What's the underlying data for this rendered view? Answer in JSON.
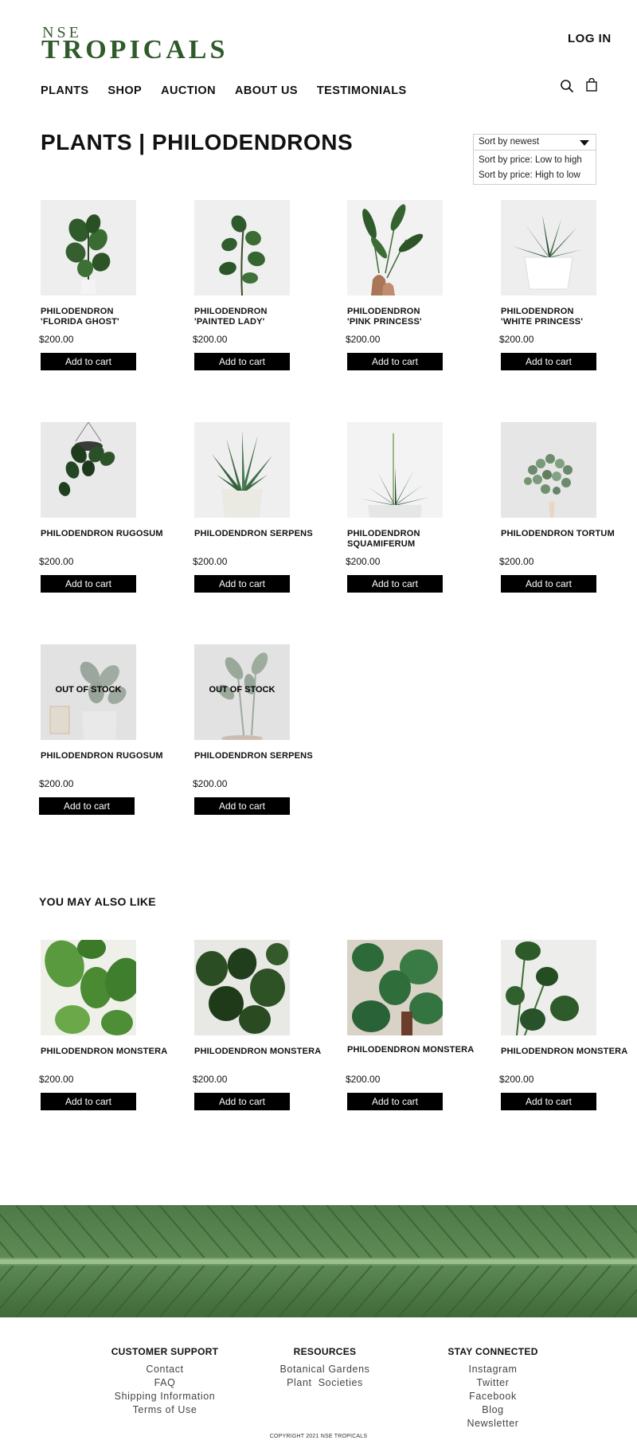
{
  "brand": {
    "line1": "NSE",
    "line2": "TROPICALS"
  },
  "header": {
    "login_label": "LOG IN",
    "nav": [
      {
        "label": "PLANTS"
      },
      {
        "label": "SHOP"
      },
      {
        "label": "AUCTION"
      },
      {
        "label": "ABOUT US"
      },
      {
        "label": "TESTIMONIALS"
      }
    ],
    "icons": {
      "search": "search-icon",
      "cart": "shopping-bag-icon"
    }
  },
  "page": {
    "title": "PLANTS |  PHILODENDRONS"
  },
  "sort": {
    "selected": "Sort by newest",
    "options": [
      "Sort by price: Low to high",
      "Sort by price: High to low"
    ]
  },
  "products": [
    {
      "name": "PHILODENDRON\n'FLORIDA GHOST'",
      "price": "$200.00",
      "button": "Add to cart"
    },
    {
      "name": "PHILODENDRON\n'PAINTED LADY'",
      "price": "$200.00",
      "button": "Add to cart"
    },
    {
      "name": "PHILODENDRON\n'PINK PRINCESS'",
      "price": "$200.00",
      "button": "Add to cart"
    },
    {
      "name": "PHILODENDRON\n'WHITE PRINCESS'",
      "price": "$200.00",
      "button": "Add to cart"
    },
    {
      "name": "PHILODENDRON RUGOSUM",
      "price": "$200.00",
      "button": "Add to cart"
    },
    {
      "name": "PHILODENDRON SERPENS",
      "price": "$200.00",
      "button": "Add to cart"
    },
    {
      "name": "PHILODENDRON\nSQUAMIFERUM",
      "price": "$200.00",
      "button": "Add to cart"
    },
    {
      "name": "PHILODENDRON TORTUM",
      "price": "$200.00",
      "button": "Add to cart"
    },
    {
      "name": "PHILODENDRON RUGOSUM",
      "price": "$200.00",
      "button": "Add to cart",
      "status": "OUT OF STOCK"
    },
    {
      "name": "PHILODENDRON SERPENS",
      "price": "$200.00",
      "button": "Add to cart",
      "status": "OUT OF STOCK"
    }
  ],
  "related": {
    "title": "YOU MAY ALSO LIKE",
    "items": [
      {
        "name": "PHILODENDRON MONSTERA",
        "price": "$200.00",
        "button": "Add to cart"
      },
      {
        "name": "PHILODENDRON MONSTERA",
        "price": "$200.00",
        "button": "Add to cart"
      },
      {
        "name": "PHILODENDRON MONSTERA",
        "price": "$200.00",
        "button": "Add to cart"
      },
      {
        "name": "PHILODENDRON MONSTERA",
        "price": "$200.00",
        "button": "Add to cart"
      }
    ]
  },
  "footer": {
    "customer_support": {
      "title": "CUSTOMER SUPPORT",
      "links": [
        "Contact",
        "FAQ",
        "Shipping Information",
        "Terms of Use"
      ]
    },
    "resources": {
      "title": "RESOURCES",
      "links": [
        "Botanical Gardens",
        "Plant  Societies"
      ]
    },
    "stay_connected": {
      "title": "STAY CONNECTED",
      "links": [
        "Instagram",
        "Twitter",
        "Facebook",
        "Blog",
        "Newsletter"
      ]
    },
    "copyright": "COPYRIGHT 2021 NSE TROPICALS"
  },
  "colors": {
    "brand_green": "#2f5a2a",
    "button_bg": "#000000",
    "banner_green": "#4f7a45"
  }
}
